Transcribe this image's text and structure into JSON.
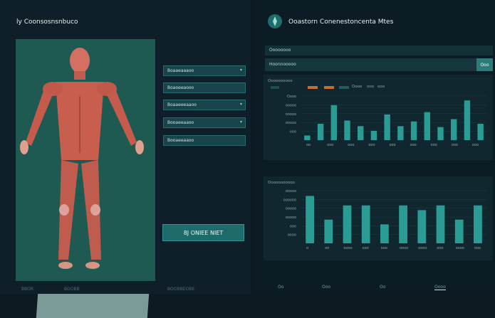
{
  "left": {
    "title": "ly Coonsosnsnbuco",
    "fields": [
      {
        "label": "Boaaeaaaoo",
        "value": "Boaaeaaaoo",
        "has_dropdown": true
      },
      {
        "label": "Boaoeeaooo",
        "value": "Boaoeeaooo",
        "has_dropdown": false
      },
      {
        "label": "Boaaeeeaaoo",
        "value": "Boaaeeeaaoo",
        "has_dropdown": true
      },
      {
        "label": "Booaeeaaoo",
        "value": "Booaeeaaoo",
        "has_dropdown": true
      },
      {
        "label": "Booaeeaaoo",
        "value": "Booaeeaaoo",
        "has_dropdown": false
      }
    ],
    "main_button": "8J ONIEE NIET",
    "footer_labels": [
      "BBOR",
      "BOOBB",
      "BOOBBEOBE"
    ]
  },
  "right": {
    "title": "Ooastorn Conenestoncenta Mtes",
    "toolbar_label": "Oooooooo",
    "search_placeholder": "Hoonnooooo",
    "search_button": "Ooo",
    "section1_title": "Oooooooooo",
    "section1_legend": [
      "",
      "",
      "Oooo",
      "ooo",
      "ooo"
    ],
    "section2_title": "Ooooooooooo",
    "colors": {
      "accent": "#2fa9a0",
      "legend_orange": "#c96d2e",
      "legend_teal": "#2b7c7a"
    },
    "chart1": {
      "type": "bar",
      "y_ticks": [
        "Oooo",
        "ooooo",
        "ooooo",
        "ooooo",
        "ooo"
      ],
      "x_ticks": [
        "oo",
        "ooo",
        "ooo",
        "ooo",
        "ooo",
        "ooo",
        "ooo",
        "ooo",
        "ooo"
      ],
      "values": [
        10,
        35,
        75,
        42,
        30,
        20,
        55,
        30,
        40,
        60,
        28,
        45,
        85,
        35
      ]
    },
    "chart2": {
      "type": "bar",
      "y_ticks": [
        "ooooo",
        "oooooo",
        "ooooo",
        "ooooo",
        "ooo",
        "oooo"
      ],
      "x_ticks": [
        "o",
        "oo",
        "oooo",
        "ooo",
        "ooo",
        "oooo",
        "oooo",
        "ooo",
        "oooo",
        "ooo"
      ],
      "values": [
        50,
        25,
        40,
        40,
        20,
        40,
        35,
        40,
        25,
        40
      ]
    },
    "footer_tabs": [
      "Oo",
      "Ooo",
      "Oo",
      "Oooo"
    ]
  }
}
